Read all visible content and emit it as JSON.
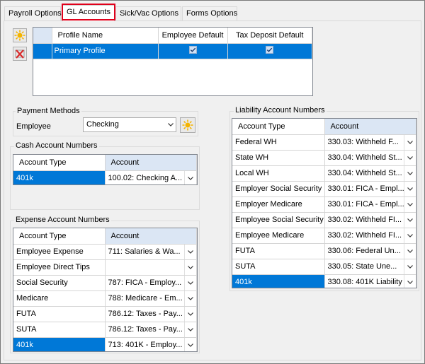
{
  "tabs": [
    {
      "label": "Payroll Options",
      "active": false
    },
    {
      "label": "GL Accounts",
      "active": true
    },
    {
      "label": "Sick/Vac Options",
      "active": false
    },
    {
      "label": "Forms Options",
      "active": false
    }
  ],
  "colors": {
    "selection": "#0078d7",
    "account_header": "#dbe6f4",
    "highlight_border": "#e0001b",
    "add_icon": "#f4b400",
    "delete_icon": "#d92b2b"
  },
  "profiles": {
    "headers": [
      "Profile Name",
      "Employee Default",
      "Tax Deposit Default"
    ],
    "rows": [
      {
        "name": "Primary Profile",
        "employee_default": true,
        "tax_deposit_default": true
      }
    ]
  },
  "payment_methods": {
    "title": "Payment Methods",
    "label": "Employee",
    "value": "Checking"
  },
  "cash_accounts": {
    "title": "Cash Account Numbers",
    "headers": [
      "Account Type",
      "Account"
    ],
    "rows": [
      {
        "type": "401k",
        "account": "100.02: Checking A..."
      }
    ]
  },
  "expense_accounts": {
    "title": "Expense Account Numbers",
    "headers": [
      "Account Type",
      "Account"
    ],
    "rows": [
      {
        "type": "Employee Expense",
        "account": "711: Salaries & Wa..."
      },
      {
        "type": "Employee Direct Tips",
        "account": ""
      },
      {
        "type": "Social Security",
        "account": "787: FICA - Employ..."
      },
      {
        "type": "Medicare",
        "account": "788: Medicare - Em..."
      },
      {
        "type": "FUTA",
        "account": "786.12: Taxes - Pay..."
      },
      {
        "type": "SUTA",
        "account": "786.12: Taxes - Pay..."
      },
      {
        "type": "401k",
        "account": "713: 401K - Employ..."
      }
    ]
  },
  "liability_accounts": {
    "title": "Liability Account Numbers",
    "headers": [
      "Account Type",
      "Account"
    ],
    "rows": [
      {
        "type": "Federal WH",
        "account": "330.03: Withheld F..."
      },
      {
        "type": "State WH",
        "account": "330.04: Withheld St..."
      },
      {
        "type": "Local WH",
        "account": "330.04: Withheld St..."
      },
      {
        "type": "Employer Social Security",
        "account": "330.01: FICA - Empl..."
      },
      {
        "type": "Employer Medicare",
        "account": "330.01: FICA - Empl..."
      },
      {
        "type": "Employee Social Security",
        "account": "330.02: Withheld FI..."
      },
      {
        "type": "Employee Medicare",
        "account": "330.02: Withheld FI..."
      },
      {
        "type": "FUTA",
        "account": "330.06: Federal Un..."
      },
      {
        "type": "SUTA",
        "account": "330.05: State Une..."
      },
      {
        "type": "401k",
        "account": "330.08: 401K Liability"
      }
    ]
  }
}
